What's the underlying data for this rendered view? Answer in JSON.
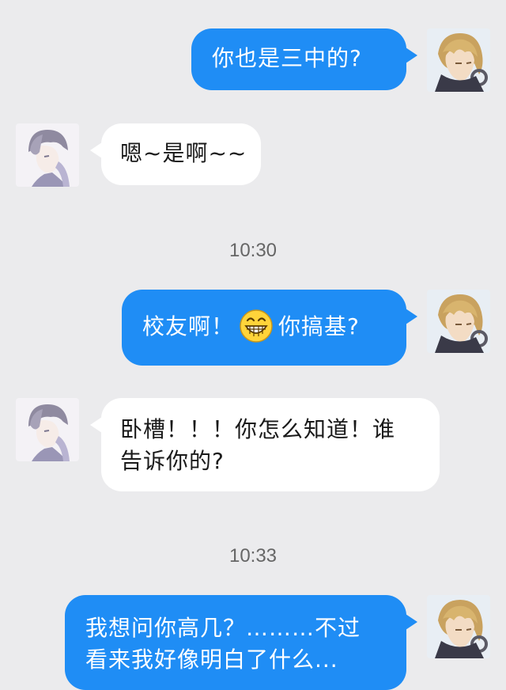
{
  "conversation": {
    "messages": [
      {
        "side": "out",
        "text": "你也是三中的?"
      },
      {
        "side": "in",
        "text": "嗯~是啊~~"
      },
      {
        "type": "time",
        "text": "10:30"
      },
      {
        "side": "out",
        "text_before": "校友啊！",
        "emoji": "grinning-face",
        "text_after": "你搞基?"
      },
      {
        "side": "in",
        "line1": "卧槽！！！你怎么知道！谁",
        "line2": "告诉你的?"
      },
      {
        "type": "time",
        "text": "10:33"
      },
      {
        "side": "out",
        "line1": "我想问你高几？………不过",
        "line2": "看来我好像明白了什么..."
      }
    ]
  },
  "colors": {
    "background": "#ebebed",
    "outgoing_bubble": "#1f8df5",
    "incoming_bubble": "#ffffff",
    "timestamp_text": "#666666"
  },
  "icons": {
    "sender_avatar": "blond-anime-boy-avatar",
    "receiver_avatar": "grey-hair-anime-avatar",
    "emoji": "grinning-face-emoji"
  }
}
